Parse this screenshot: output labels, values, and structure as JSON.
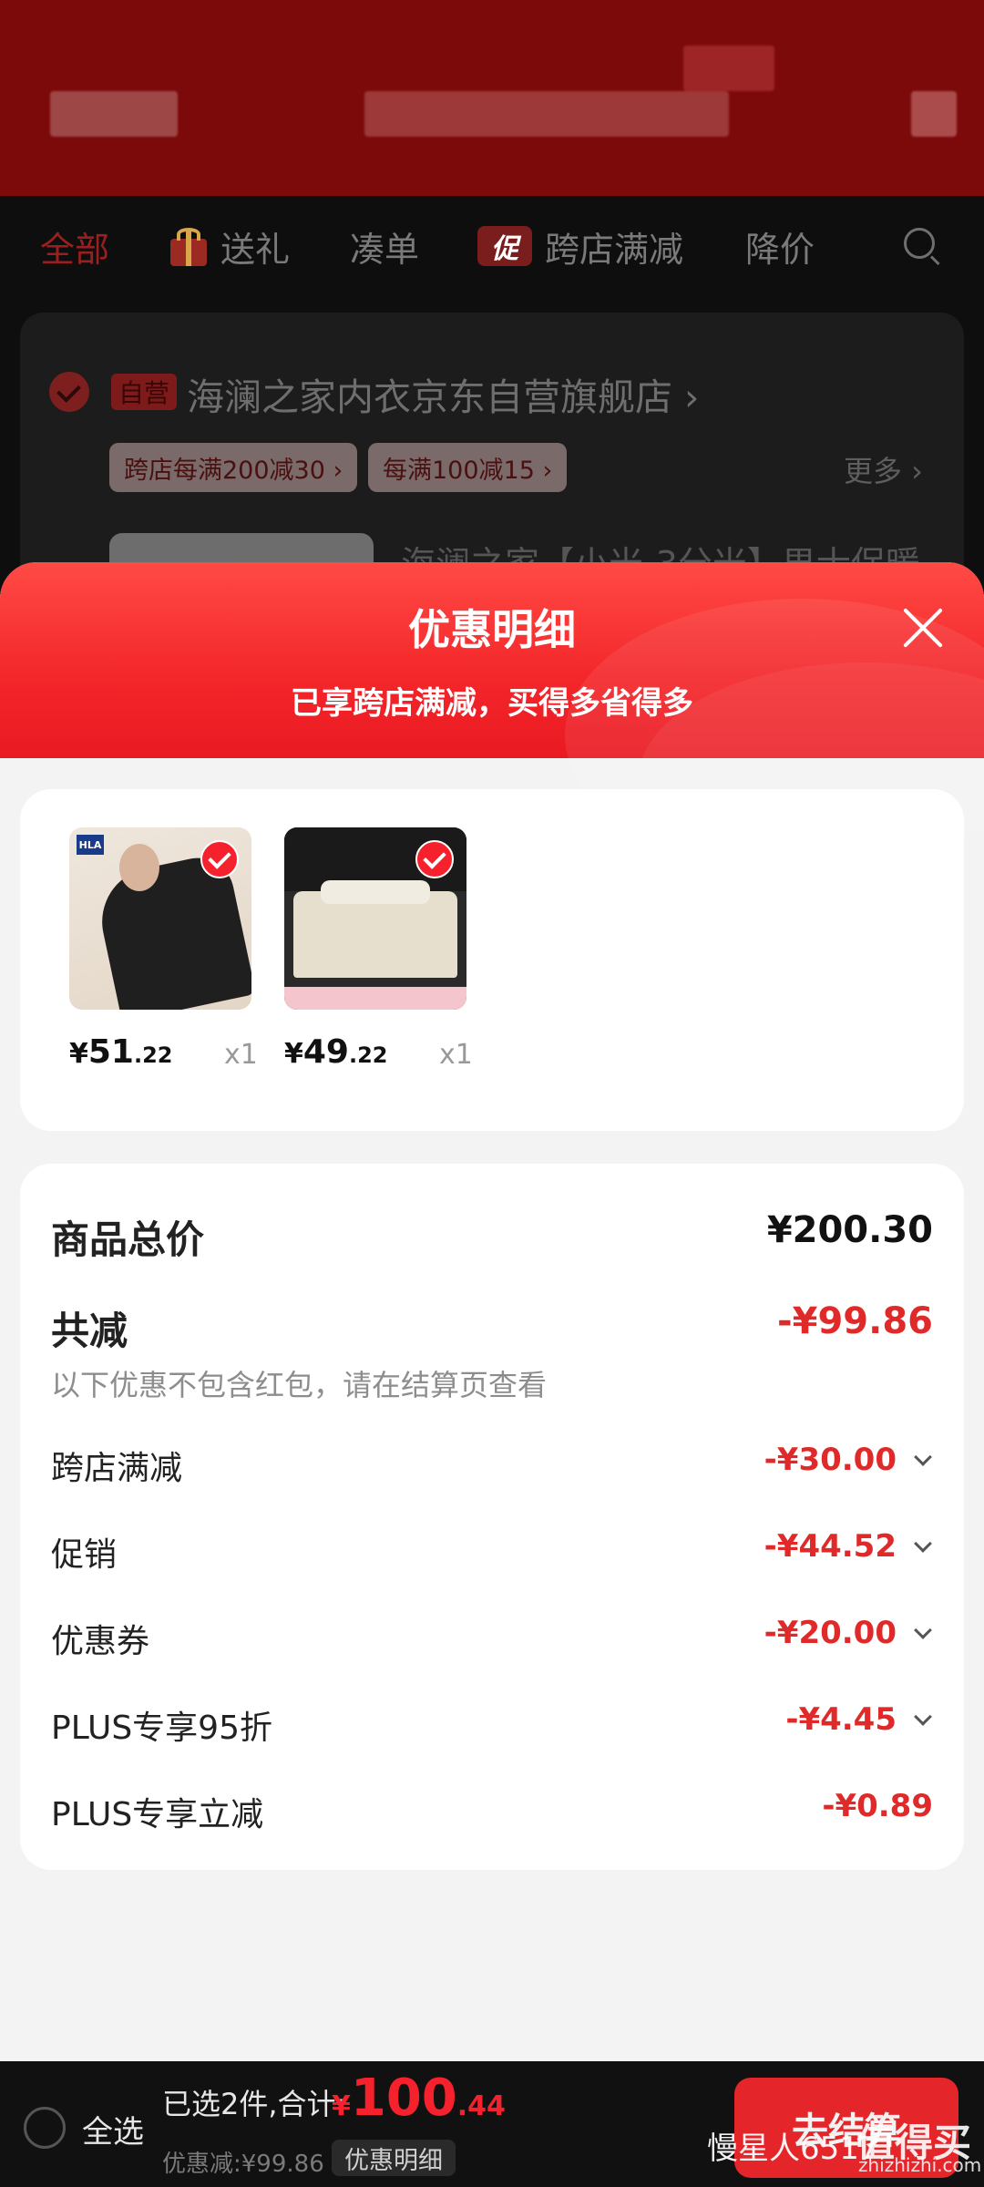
{
  "tabs": [
    {
      "label": "全部"
    },
    {
      "label": "送礼"
    },
    {
      "label": "凑单"
    },
    {
      "label": "跨店满减",
      "badge": "促"
    },
    {
      "label": "降价"
    }
  ],
  "store": {
    "badge": "自营",
    "name": "海澜之家内衣京东自营旗舰店 ›",
    "coupons": [
      "跨店每满200减30 ›",
      "每满100减15 ›"
    ],
    "more": "更多 ›",
    "product_title_partial": "海澜之家【小米-3分米】男士保暖"
  },
  "sheet": {
    "title": "优惠明细",
    "subtitle": "已享跨店满减，买得多省得多"
  },
  "items": [
    {
      "price_symbol": "¥",
      "price_int": "51",
      "price_dec": ".22",
      "qty": "x1"
    },
    {
      "price_symbol": "¥",
      "price_int": "49",
      "price_dec": ".22",
      "qty": "x1"
    }
  ],
  "summary": {
    "total_label": "商品总价",
    "total_value": "¥200.30",
    "reduce_label": "共减",
    "reduce_value": "-¥99.86",
    "note": "以下优惠不包含红包，请在结算页查看",
    "lines": [
      {
        "label": "跨店满减",
        "value": "-¥30.00"
      },
      {
        "label": "促销",
        "value": "-¥44.52"
      },
      {
        "label": "优惠券",
        "value": "-¥20.00"
      },
      {
        "label": "PLUS专享95折",
        "value": "-¥4.45"
      },
      {
        "label": "PLUS专享立减",
        "value": "-¥0.89"
      }
    ]
  },
  "bottom": {
    "select_all": "全选",
    "selected_text": "已选2件,合计:",
    "price_symbol": "¥",
    "price_int": "100",
    "price_dec": ".44",
    "discount_text": "优惠减:¥99.86",
    "detail_button": "优惠明细",
    "checkout": "去结算"
  },
  "watermark": {
    "user": "慢星人6517",
    "logo": "值得买",
    "url": "zhizhizhi.com"
  },
  "colors": {
    "accent": "#f5222d",
    "header_red": "#7d0a0a",
    "discount_red": "#e02a2a"
  }
}
